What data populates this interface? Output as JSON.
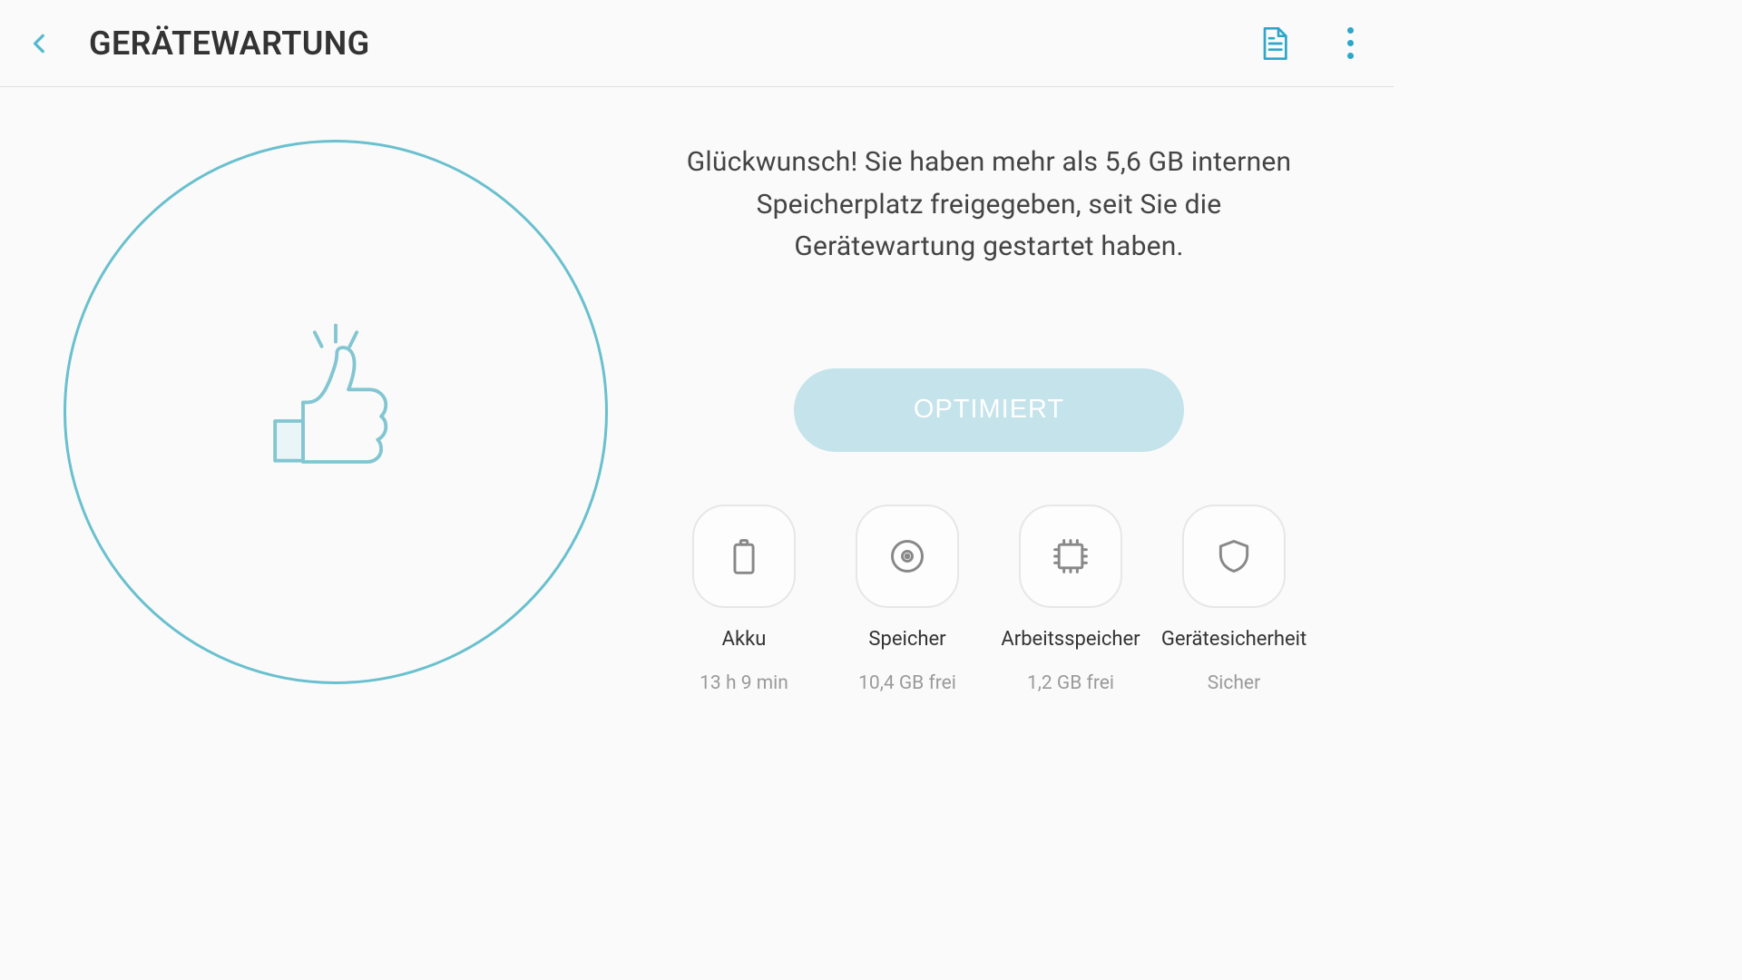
{
  "header": {
    "title": "GERÄTEWARTUNG"
  },
  "status": {
    "message": "Glückwunsch! Sie haben mehr als 5,6 GB internen Speicherplatz freigegeben, seit Sie die Gerätewartung gestartet haben."
  },
  "actions": {
    "optimize_label": "OPTIMIERT"
  },
  "tiles": [
    {
      "id": "battery",
      "label": "Akku",
      "value": "13 h 9 min",
      "icon": "battery-icon"
    },
    {
      "id": "storage",
      "label": "Speicher",
      "value": "10,4 GB frei",
      "icon": "storage-icon"
    },
    {
      "id": "memory",
      "label": "Arbeitsspeicher",
      "value": "1,2 GB frei",
      "icon": "memory-icon"
    },
    {
      "id": "security",
      "label": "Gerätesicherheit",
      "value": "Sicher",
      "icon": "shield-icon"
    }
  ]
}
